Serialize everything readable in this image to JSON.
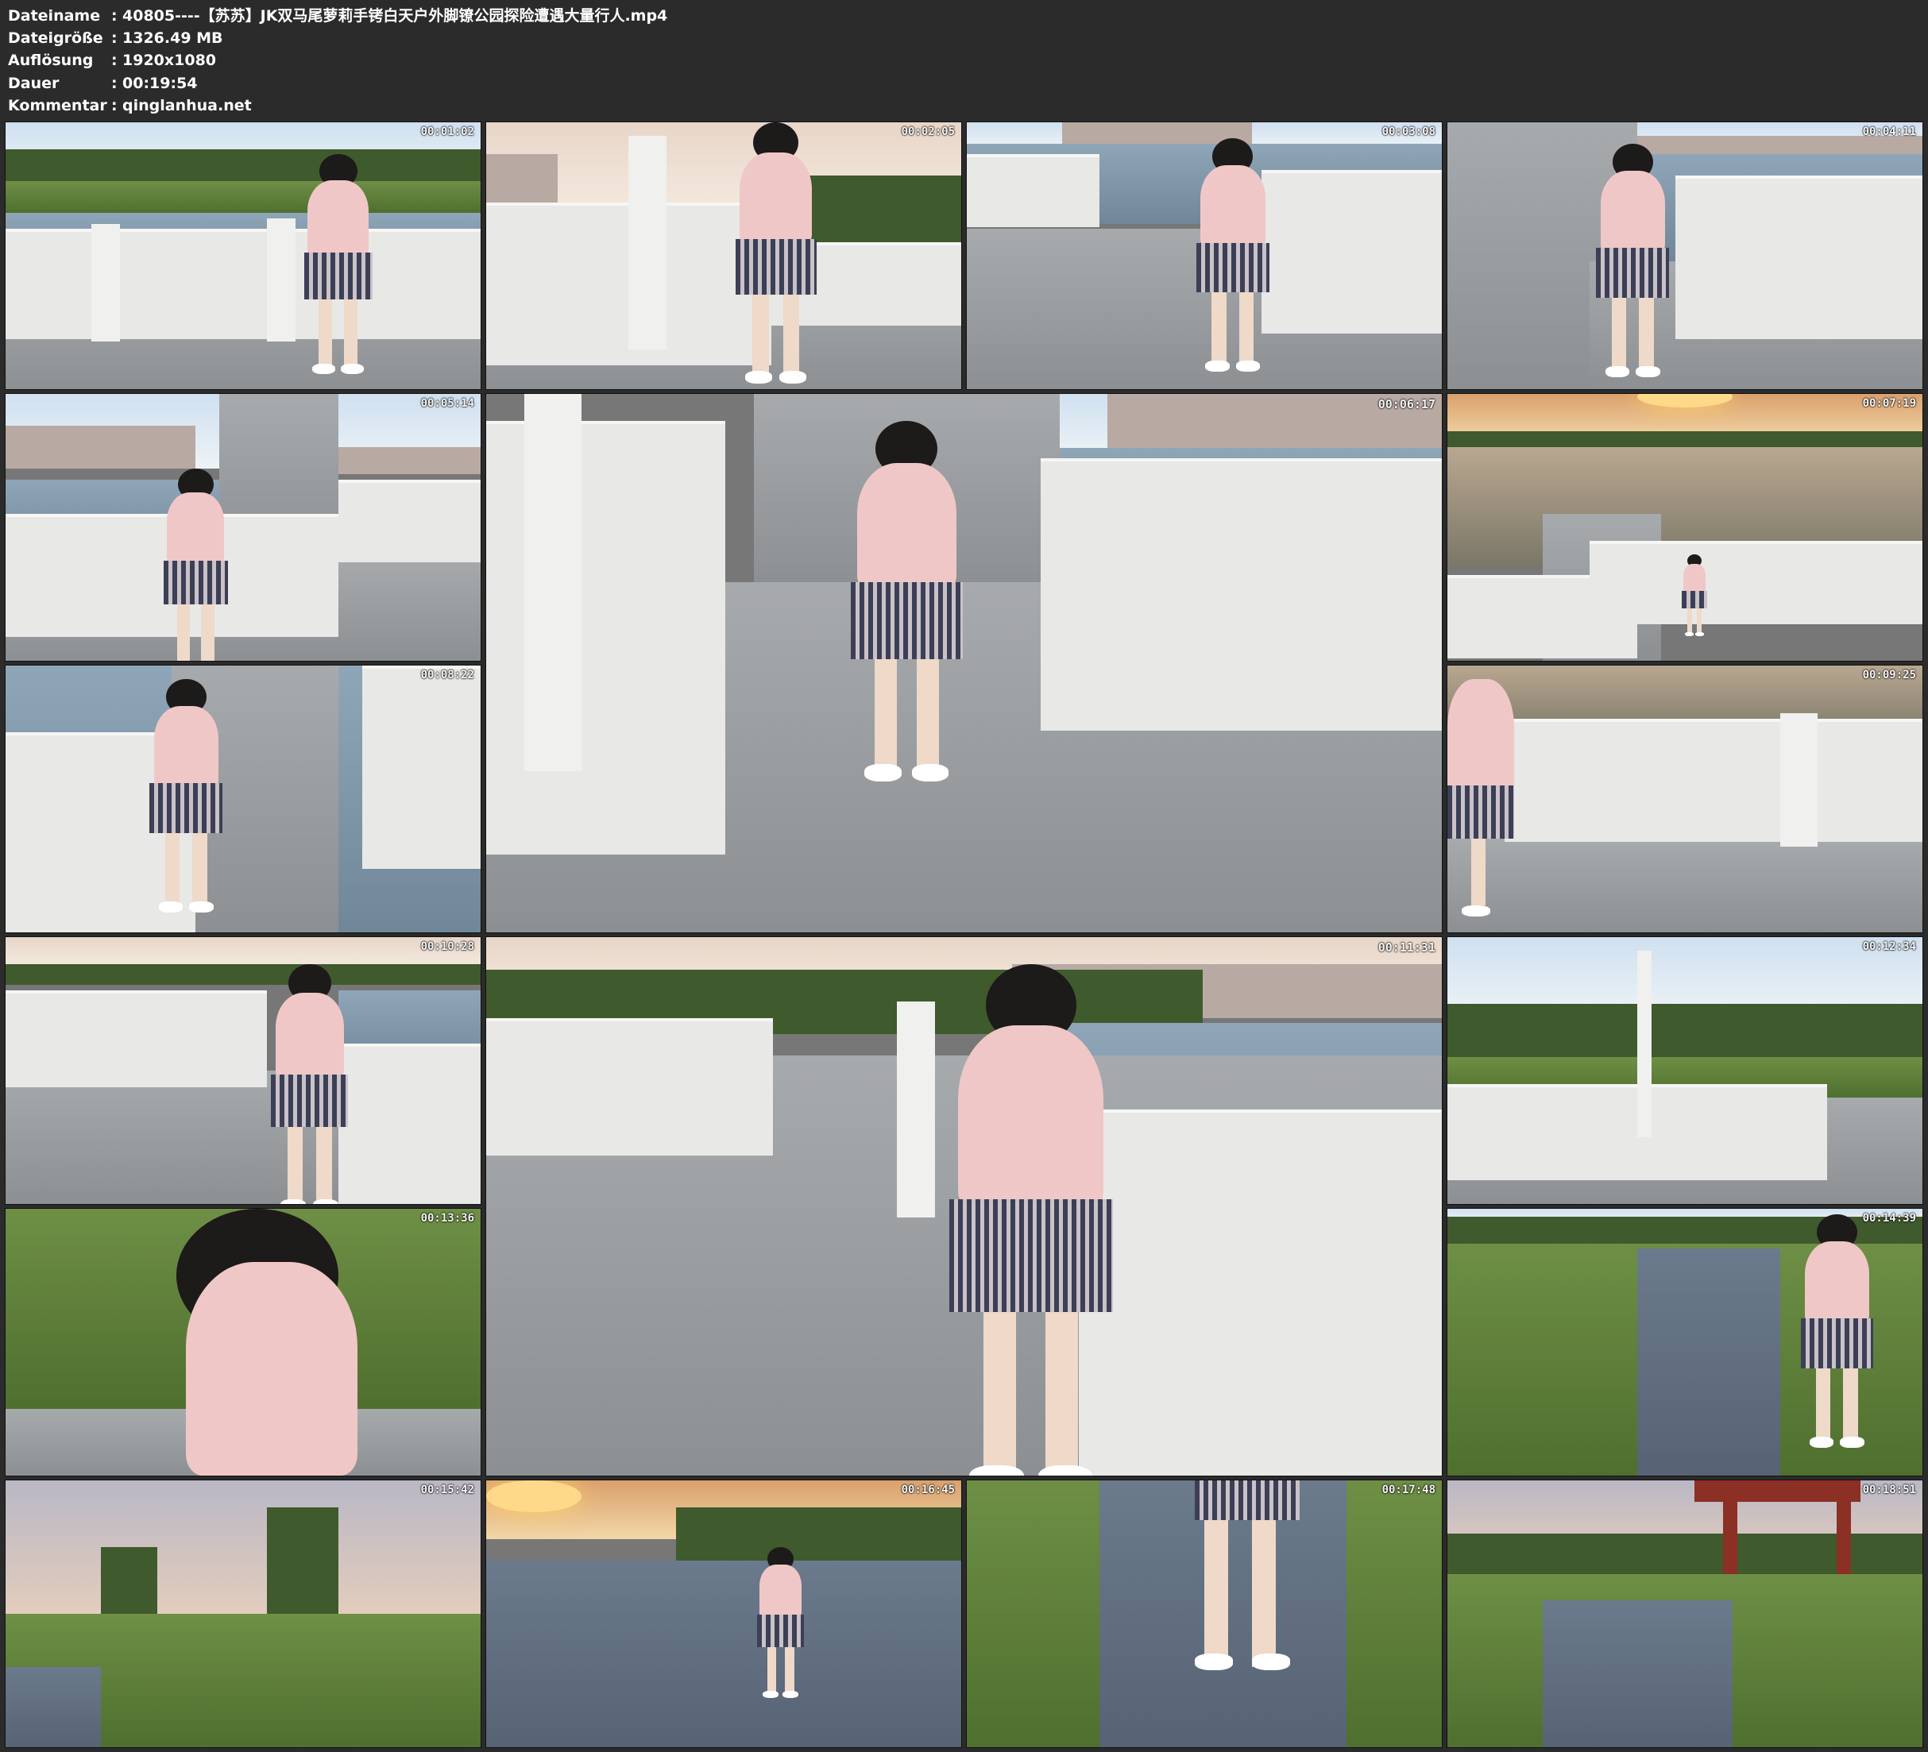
{
  "metadata": {
    "rows": [
      {
        "label": "Dateiname",
        "value": "40805----【苏苏】JK双马尾萝莉手铐白天户外脚镣公园探险遭遇大量行人.mp4"
      },
      {
        "label": "Dateigröße",
        "value": "1326.49 MB"
      },
      {
        "label": "Auflösung",
        "value": "1920x1080"
      },
      {
        "label": "Dauer",
        "value": "00:19:54"
      },
      {
        "label": "Kommentar",
        "value": "qinglanhua.net"
      }
    ],
    "separator": ":"
  },
  "thumbnails": [
    {
      "timestamp": "00:01:02",
      "scene": "bridge-railing-grass"
    },
    {
      "timestamp": "00:02:05",
      "scene": "arched-bridge-steps"
    },
    {
      "timestamp": "00:03:08",
      "scene": "bridge-walkway-water"
    },
    {
      "timestamp": "00:04:11",
      "scene": "bridge-stairs-river"
    },
    {
      "timestamp": "00:05:14",
      "scene": "bridge-stairs-buildings"
    },
    {
      "timestamp": "00:06:17",
      "scene": "stone-walkway-large"
    },
    {
      "timestamp": "00:07:19",
      "scene": "sunset-lake-pier"
    },
    {
      "timestamp": "00:08:22",
      "scene": "long-pier-water"
    },
    {
      "timestamp": "00:09:25",
      "scene": "railing-closeup-evening"
    },
    {
      "timestamp": "00:10:28",
      "scene": "walkway-masked-girl"
    },
    {
      "timestamp": "00:11:31",
      "scene": "lakeside-walkway-large"
    },
    {
      "timestamp": "00:12:34",
      "scene": "plaza-bridge-lamp"
    },
    {
      "timestamp": "00:13:36",
      "scene": "grass-closeup"
    },
    {
      "timestamp": "00:14:39",
      "scene": "winding-brick-path"
    },
    {
      "timestamp": "00:15:42",
      "scene": "dusk-trees-path"
    },
    {
      "timestamp": "00:16:45",
      "scene": "sunset-brick-path"
    },
    {
      "timestamp": "00:17:48",
      "scene": "brick-path-legs"
    },
    {
      "timestamp": "00:18:51",
      "scene": "pavilion-path"
    }
  ],
  "colors": {
    "background": "#2b2b2b",
    "text": "#ffffff"
  }
}
